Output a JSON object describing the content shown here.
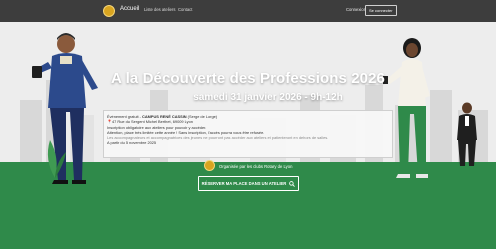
{
  "nav": {
    "brand": "Accueil",
    "links": [
      "Liste des ateliers",
      "Contact"
    ],
    "login": "Connexion",
    "signup": "Se connecter"
  },
  "hero": {
    "title": "A la Découverte des Professions 2026",
    "date": "samedi 31 janvier 2026 - 9h-12h"
  },
  "info": {
    "line1_prefix": "Événement gratuit - ",
    "line1_venue": "CAMPUS RENÉ CASSIN",
    "line1_suffix": " (Serge de Lorge)",
    "address": "47 Rue du Sergent Michel Berthet, 69009 Lyon",
    "line3": "Inscription obligatoire aux ateliers pour pouvoir y accéder.",
    "line4": "Attention, place très limitée cette année ! Sans inscription, l'accès pourra vous être refusée.",
    "line5": "Les accompagnateurs et accompagnatrices des jeunes ne pourront pas accéder aux ateliers et patienteront en dehors de salles.",
    "line6": "A partir du 5 novembre 2025"
  },
  "organiser": "Organisée par les clubs Rotary de Lyon",
  "cta": {
    "label": "RÉSERVER MA PLACE DANS UN ATELIER"
  },
  "colors": {
    "navbar": "#3d3d3d",
    "green": "#2f8a4a",
    "gold": "#d9a520"
  }
}
